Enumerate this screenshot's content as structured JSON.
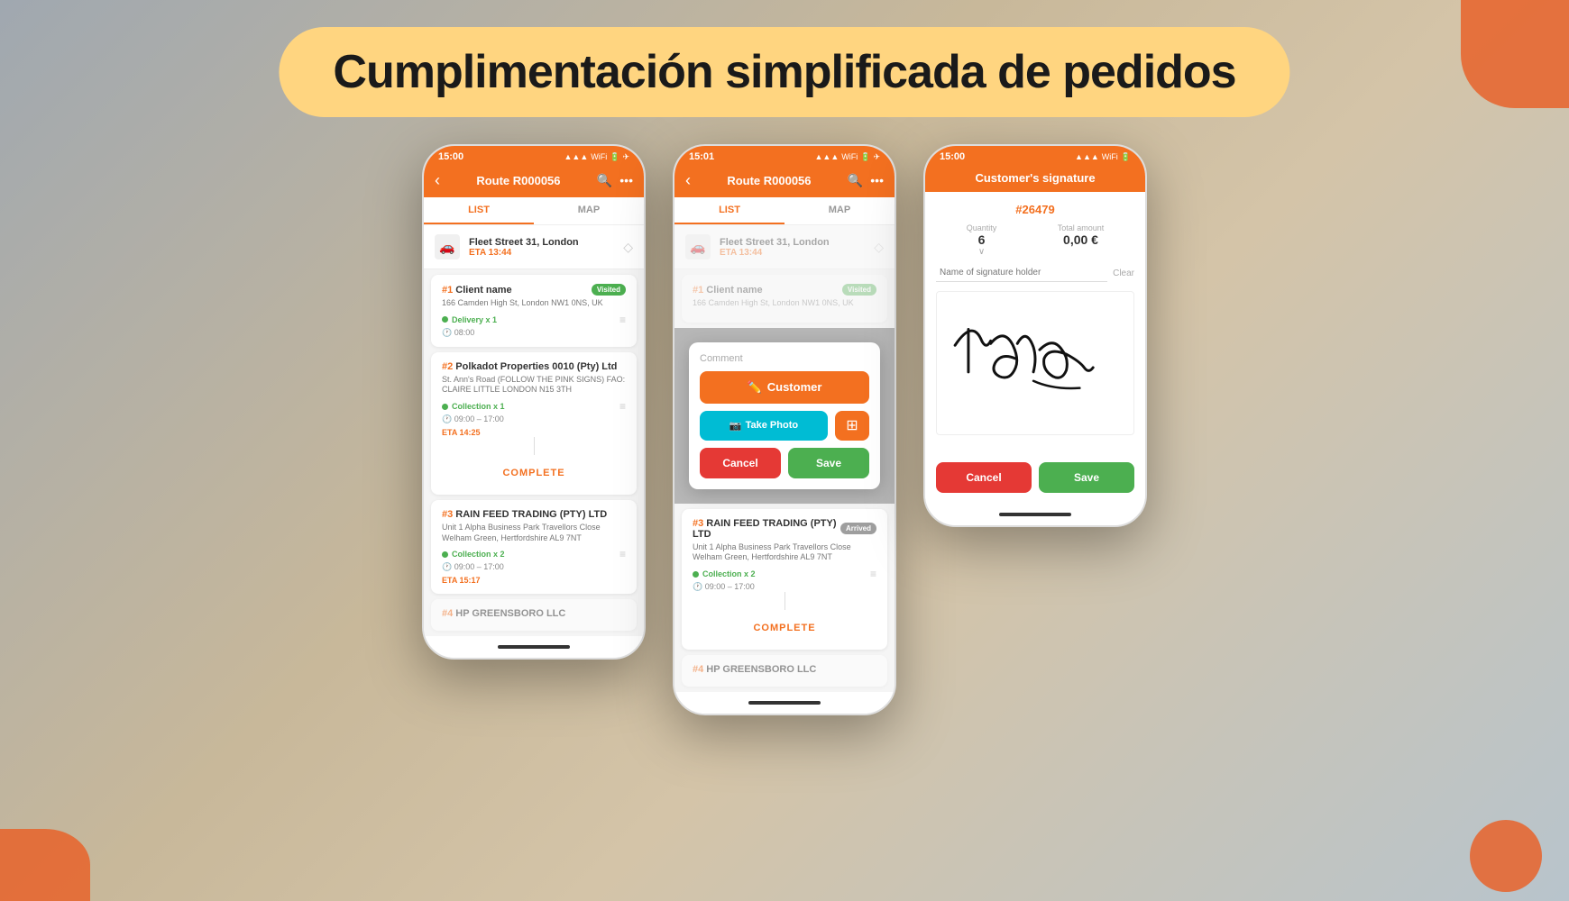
{
  "title": "Cumplimentación simplificada de pedidos",
  "phone1": {
    "status_time": "15:00",
    "nav_title": "Route R000056",
    "tab_list": "LIST",
    "tab_map": "MAP",
    "location": {
      "name": "Fleet Street 31, London",
      "eta": "ETA 13:44"
    },
    "stops": [
      {
        "num": "#1",
        "name": "Client name",
        "badge": "Visited",
        "address": "166 Camden High St, London NW1 0NS, UK",
        "collection": "Delivery x 1",
        "time": "08:00",
        "eta": null
      },
      {
        "num": "#2",
        "name": "Polkadot Properties 0010 (Pty) Ltd",
        "badge": null,
        "address": "St. Ann's Road (FOLLOW THE PINK SIGNS) FAO: CLAIRE LITTLE LONDON N15 3TH",
        "collection": "Collection x 1",
        "time": "09:00 – 17:00",
        "eta": "ETA 14:25",
        "complete": "COMPLETE"
      },
      {
        "num": "#3",
        "name": "RAIN FEED TRADING (PTY) LTD",
        "badge": null,
        "address": "Unit 1 Alpha Business Park Travellors Close Welham Green, Hertfordshire AL9 7NT",
        "collection": "Collection x 2",
        "time": "09:00 – 17:00",
        "eta": "ETA 15:17"
      },
      {
        "num": "#4",
        "name": "HP GREENSBORO LLC",
        "badge": null,
        "address": "",
        "collection": "",
        "time": "",
        "eta": null
      }
    ]
  },
  "phone2": {
    "status_time": "15:01",
    "nav_title": "Route R000056",
    "tab_list": "LIST",
    "tab_map": "MAP",
    "location": {
      "name": "Fleet Street 31, London",
      "eta": "ETA 13:44"
    },
    "stop1": {
      "num": "#1",
      "name": "Client name",
      "badge": "Visited",
      "address": "166 Camden High St, London NW1 0NS, UK"
    },
    "comment_modal": {
      "label": "Comment",
      "btn_customer": "Customer",
      "btn_take_photo": "Take Photo",
      "btn_cancel": "Cancel",
      "btn_save": "Save"
    },
    "stop3": {
      "num": "#3",
      "name": "RAIN FEED TRADING (PTY) LTD",
      "badge": "Arrived",
      "address": "Unit 1 Alpha Business Park Travellors Close Welham Green, Hertfordshire AL9 7NT",
      "collection": "Collection x 2",
      "time": "09:00 – 17:00",
      "complete": "COMPLETE"
    },
    "stop4": {
      "num": "#4",
      "name": "HP GREENSBORO LLC"
    }
  },
  "phone3": {
    "status_time": "15:00",
    "nav_title": "Customer's signature",
    "order_num": "#26479",
    "quantity_label": "Quantity",
    "quantity_val": "6",
    "total_label": "Total amount",
    "total_val": "0,00 €",
    "name_placeholder": "Name of signature holder",
    "clear_btn": "Clear",
    "btn_cancel": "Cancel",
    "btn_save": "Save"
  }
}
